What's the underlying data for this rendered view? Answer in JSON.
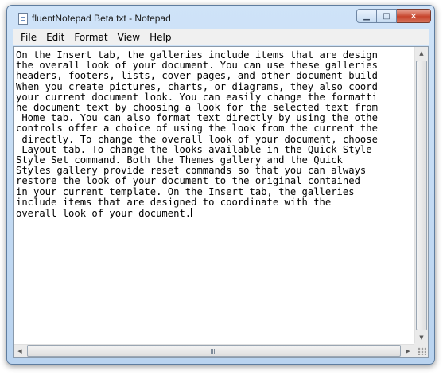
{
  "window": {
    "title": "fluentNotepad Beta.txt - Notepad",
    "minimize_glyph": "▁",
    "maximize_glyph": "□",
    "close_glyph": "✕",
    "icon": "notepad-icon"
  },
  "menu": [
    {
      "label": "File"
    },
    {
      "label": "Edit"
    },
    {
      "label": "Format"
    },
    {
      "label": "View"
    },
    {
      "label": "Help"
    }
  ],
  "document": {
    "lines": [
      "On the Insert tab, the galleries include items that are design",
      "the overall look of your document. You can use these galleries",
      "headers, footers, lists, cover pages, and other document build",
      "When you create pictures, charts, or diagrams, they also coord",
      "your current document look. You can easily change the formatti",
      "he document text by choosing a look for the selected text from",
      " Home tab. You can also format text directly by using the othe",
      "controls offer a choice of using the look from the current the",
      " directly. To change the overall look of your document, choose",
      " Layout tab. To change the looks available in the Quick Style",
      "Style Set command. Both the Themes gallery and the Quick",
      "Styles gallery provide reset commands so that you can always",
      "restore the look of your document to the original contained",
      "in your current template. On the Insert tab, the galleries",
      "include items that are designed to coordinate with the",
      "overall look of your document."
    ]
  },
  "scrollbars": {
    "up_arrow": "▲",
    "down_arrow": "▼",
    "left_arrow": "◀",
    "right_arrow": "▶"
  },
  "colors": {
    "frame": "#b9d3ef",
    "close_button": "#c7442c"
  }
}
